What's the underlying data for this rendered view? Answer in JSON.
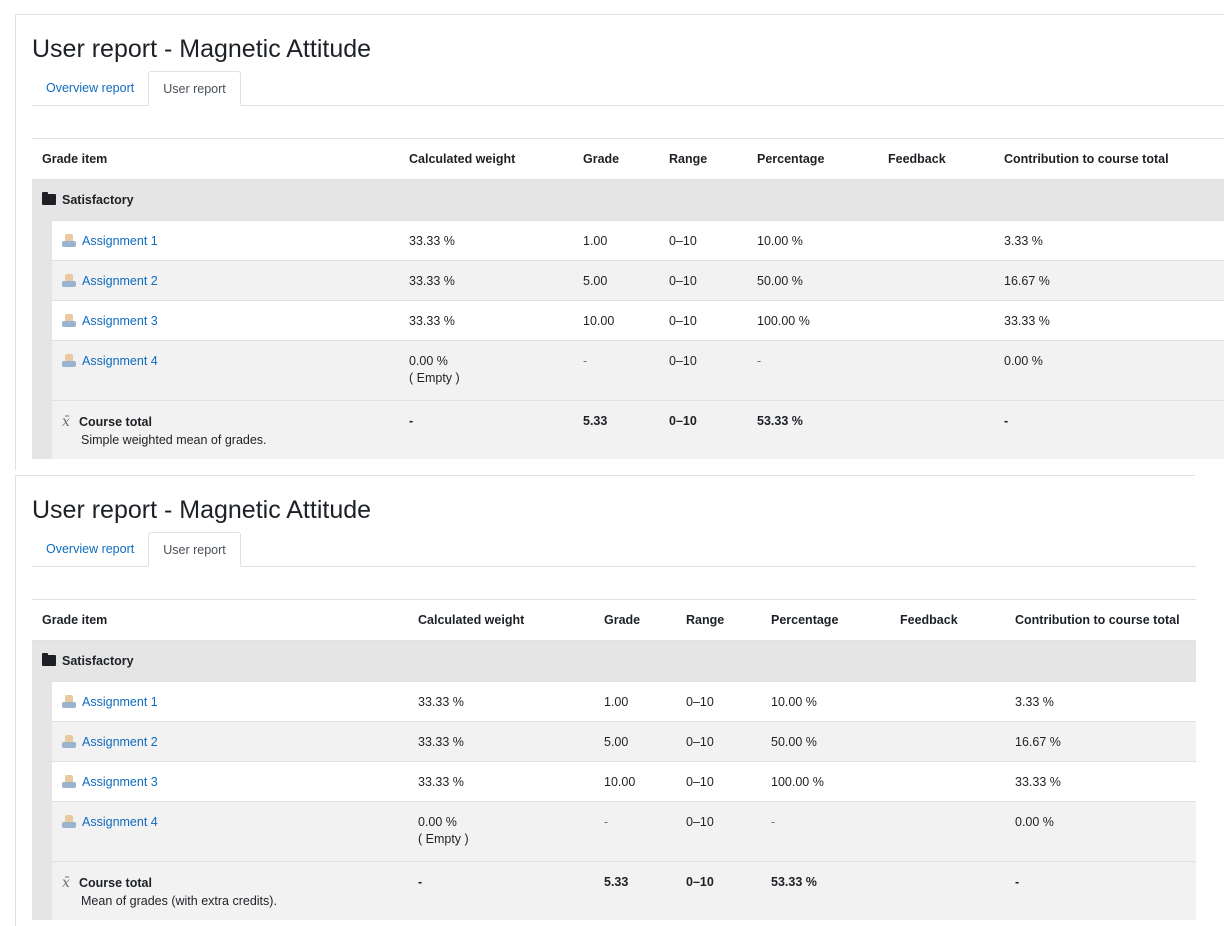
{
  "reports": [
    {
      "title": "User report - Magnetic Attitude",
      "tabs": [
        "Overview report",
        "User report"
      ],
      "columns": [
        "Grade item",
        "Calculated weight",
        "Grade",
        "Range",
        "Percentage",
        "Feedback",
        "Contribution to course total"
      ],
      "category": "Satisfactory",
      "items": [
        {
          "name": "Assignment 1",
          "weight": "33.33 %",
          "weight_note": "",
          "grade": "1.00",
          "range": "0–10",
          "percentage": "10.00 %",
          "feedback": "",
          "contribution": "3.33 %"
        },
        {
          "name": "Assignment 2",
          "weight": "33.33 %",
          "weight_note": "",
          "grade": "5.00",
          "range": "0–10",
          "percentage": "50.00 %",
          "feedback": "",
          "contribution": "16.67 %"
        },
        {
          "name": "Assignment 3",
          "weight": "33.33 %",
          "weight_note": "",
          "grade": "10.00",
          "range": "0–10",
          "percentage": "100.00 %",
          "feedback": "",
          "contribution": "33.33 %"
        },
        {
          "name": "Assignment 4",
          "weight": "0.00 %",
          "weight_note": "( Empty )",
          "grade": "-",
          "range": "0–10",
          "percentage": "-",
          "feedback": "",
          "contribution": "0.00 %"
        }
      ],
      "total": {
        "name": "Course total",
        "note": "Simple weighted mean of grades.",
        "weight": "-",
        "grade": "5.33",
        "range": "0–10",
        "percentage": "53.33 %",
        "feedback": "",
        "contribution": "-"
      }
    },
    {
      "title": "User report - Magnetic Attitude",
      "tabs": [
        "Overview report",
        "User report"
      ],
      "columns": [
        "Grade item",
        "Calculated weight",
        "Grade",
        "Range",
        "Percentage",
        "Feedback",
        "Contribution to course total"
      ],
      "category": "Satisfactory",
      "items": [
        {
          "name": "Assignment 1",
          "weight": "33.33 %",
          "weight_note": "",
          "grade": "1.00",
          "range": "0–10",
          "percentage": "10.00 %",
          "feedback": "",
          "contribution": "3.33 %"
        },
        {
          "name": "Assignment 2",
          "weight": "33.33 %",
          "weight_note": "",
          "grade": "5.00",
          "range": "0–10",
          "percentage": "50.00 %",
          "feedback": "",
          "contribution": "16.67 %"
        },
        {
          "name": "Assignment 3",
          "weight": "33.33 %",
          "weight_note": "",
          "grade": "10.00",
          "range": "0–10",
          "percentage": "100.00 %",
          "feedback": "",
          "contribution": "33.33 %"
        },
        {
          "name": "Assignment 4",
          "weight": "0.00 %",
          "weight_note": "( Empty )",
          "grade": "-",
          "range": "0–10",
          "percentage": "-",
          "feedback": "",
          "contribution": "0.00 %"
        }
      ],
      "total": {
        "name": "Course total",
        "note": "Mean of grades (with extra credits).",
        "weight": "-",
        "grade": "5.33",
        "range": "0–10",
        "percentage": "53.33 %",
        "feedback": "",
        "contribution": "-"
      }
    }
  ],
  "icons": {
    "category": "folder-icon",
    "item": "assignment-icon",
    "total": "mean-icon",
    "mean_glyph": "x̄"
  },
  "colors": {
    "link": "#0f6cbf",
    "category_bg": "#e5e5e5",
    "stripe_bg": "#f2f2f2",
    "muted": "#6a737b"
  }
}
